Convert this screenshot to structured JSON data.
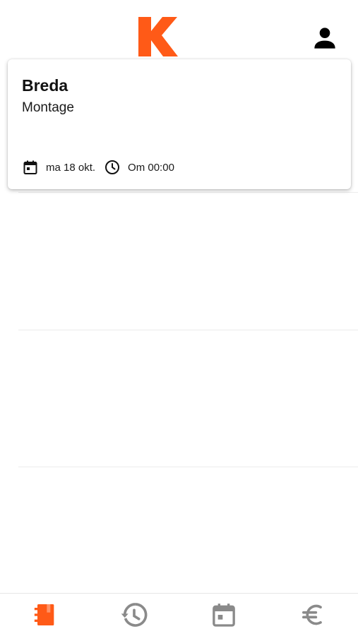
{
  "header": {
    "logo_letter": "K",
    "logo_icon": "brand-k-logo",
    "profile_icon": "person-icon"
  },
  "card": {
    "title": "Breda",
    "subtitle": "Montage",
    "date_icon": "calendar-icon",
    "date": "ma 18 okt.",
    "time_icon": "clock-icon",
    "time": "Om 00:00"
  },
  "bottom_nav": {
    "items": [
      {
        "icon": "notebook-icon",
        "active": true
      },
      {
        "icon": "history-icon",
        "active": false
      },
      {
        "icon": "calendar-icon",
        "active": false
      },
      {
        "icon": "euro-icon",
        "active": false
      }
    ]
  },
  "colors": {
    "brand": "#FF5A17",
    "inactive_icon": "#8a8a8a",
    "text": "#111111",
    "divider": "#ececec"
  }
}
